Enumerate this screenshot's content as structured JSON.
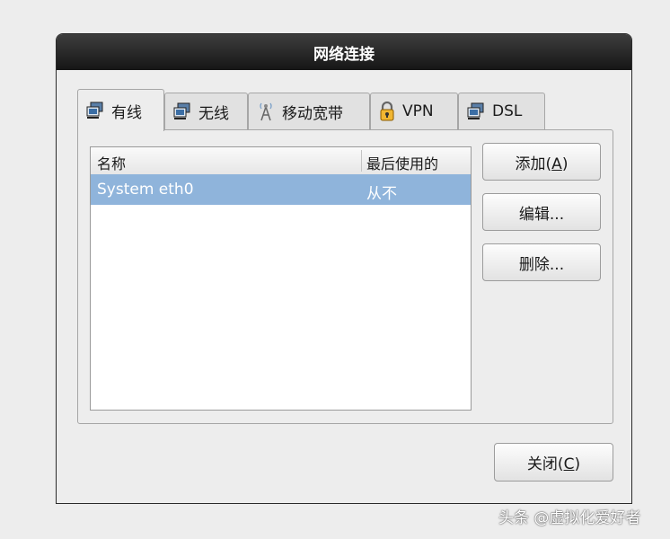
{
  "window": {
    "title": "网络连接"
  },
  "tabs": [
    {
      "label": "有线",
      "icon": "network-wired-icon",
      "active": true
    },
    {
      "label": "无线",
      "icon": "network-wireless-icon",
      "active": false
    },
    {
      "label": "移动宽带",
      "icon": "antenna-icon",
      "active": false
    },
    {
      "label": "VPN",
      "icon": "lock-icon",
      "active": false
    },
    {
      "label": "DSL",
      "icon": "network-dsl-icon",
      "active": false
    }
  ],
  "list": {
    "columns": {
      "name": "名称",
      "last_used": "最后使用的"
    },
    "rows": [
      {
        "name": "System eth0",
        "last_used": "从不",
        "selected": true
      }
    ]
  },
  "buttons": {
    "add_prefix": "添加(",
    "add_mnemonic": "A",
    "add_suffix": ")",
    "edit": "编辑...",
    "delete": "删除...",
    "close_prefix": "关闭(",
    "close_mnemonic": "C",
    "close_suffix": ")"
  },
  "watermark": "头条 @虚拟化爱好者",
  "colors": {
    "selection": "#8fb4db",
    "titlebar": "#1e1e1e"
  }
}
